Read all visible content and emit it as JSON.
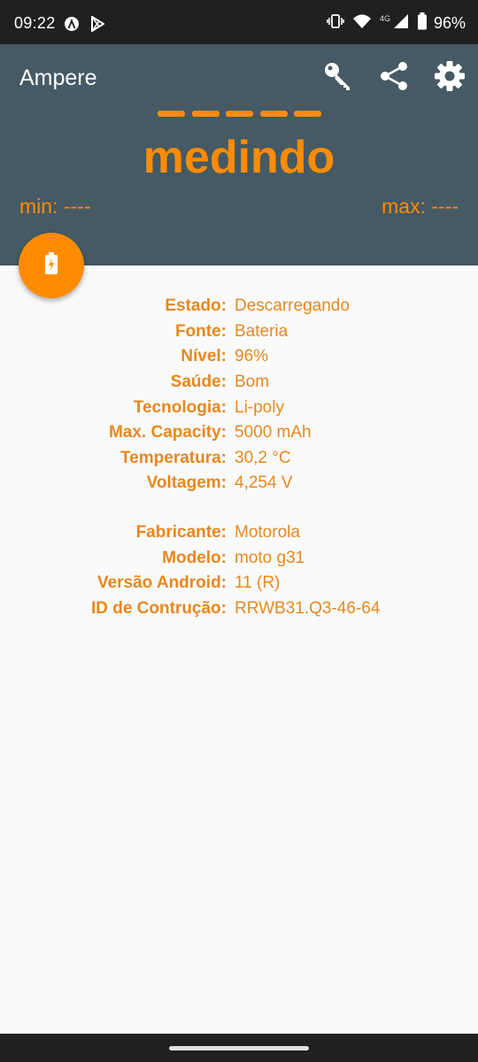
{
  "status_bar": {
    "time": "09:22",
    "network": "4G",
    "battery": "96%"
  },
  "app_bar": {
    "title": "Ampere",
    "actions": [
      "key-icon",
      "share-icon",
      "settings-icon"
    ]
  },
  "meter": {
    "status": "medindo",
    "min_label": "min: ----",
    "max_label": "max: ----"
  },
  "colors": {
    "accent": "#ff8c00",
    "appbar": "#455a64",
    "text": "#e8871e",
    "background": "#fafafa"
  },
  "battery_info": [
    {
      "label": "Estado:",
      "value": "Descarregando"
    },
    {
      "label": "Fonte:",
      "value": "Bateria"
    },
    {
      "label": "Nível:",
      "value": "96%"
    },
    {
      "label": "Saúde:",
      "value": "Bom"
    },
    {
      "label": "Tecnologia:",
      "value": "Li-poly"
    },
    {
      "label": "Max. Capacity:",
      "value": "5000 mAh"
    },
    {
      "label": "Temperatura:",
      "value": "30,2 °C"
    },
    {
      "label": "Voltagem:",
      "value": "4,254 V"
    }
  ],
  "device_info": [
    {
      "label": "Fabricante:",
      "value": "Motorola"
    },
    {
      "label": "Modelo:",
      "value": "moto g31"
    },
    {
      "label": "Versão Android:",
      "value": "11 (R)"
    },
    {
      "label": "ID de Contrução:",
      "value": "RRWB31.Q3-46-64"
    }
  ]
}
